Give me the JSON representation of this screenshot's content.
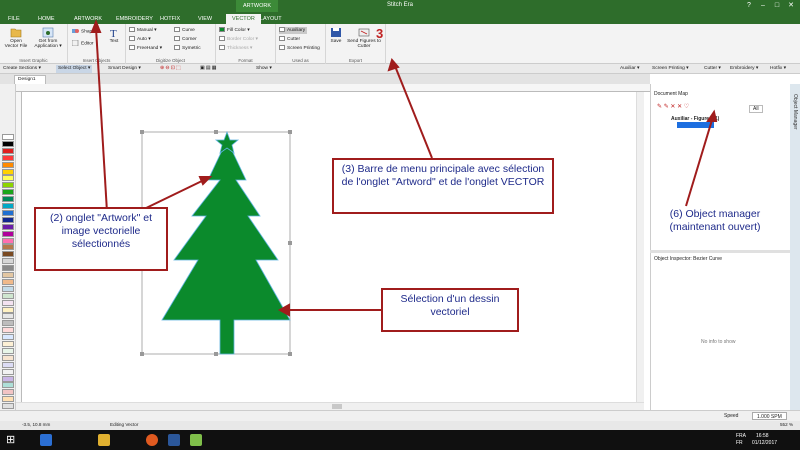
{
  "app": {
    "title": "Stitch Era",
    "context_tab": "ARTWORK"
  },
  "quick_access": {
    "file_label": "FILE"
  },
  "window_buttons": {
    "minimize": "–",
    "maximize": "□",
    "close": "✕",
    "help": "?"
  },
  "tabs": [
    {
      "label": "FILE"
    },
    {
      "label": "HOME"
    },
    {
      "label": "ARTWORK"
    },
    {
      "label": "EMBROIDERY"
    },
    {
      "label": "HOTFIX"
    },
    {
      "label": "VIEW"
    },
    {
      "label": "VECTOR",
      "active": true
    },
    {
      "label": "LAYOUT"
    }
  ],
  "ribbon": {
    "insert_graphic": {
      "label": "Insert Graphic",
      "open_vector": "Open Vector File",
      "get_from_app": "Get from Application ▾"
    },
    "insert_objects": {
      "label": "Insert Objects",
      "shapes": "Shapes",
      "editor": "Editor",
      "text": "Text"
    },
    "digitize_object": {
      "label": "Digitize Object",
      "manual": "Manual ▾",
      "auto": "Auto ▾",
      "freehand": "FreeHand ▾",
      "curve": "Curve",
      "corner": "Corner",
      "symmetric": "Symetric"
    },
    "format": {
      "label": "Format",
      "fill_color": "Fill Color ▾",
      "border_color": "Border Color ▾",
      "thickness": "Thickness ▾"
    },
    "used_as": {
      "label": "Used as",
      "auxiliary": "Auxiliary",
      "cutter": "Cutter",
      "screen_printing": "Screen Printing"
    },
    "export": {
      "label": "Export",
      "save": "Save",
      "send_figures": "Send Figures to Cutter"
    }
  },
  "toolbar2": {
    "create_sections": "Create Sections ▾",
    "select_object": "Select Object ▾",
    "smart_design": "Smart Design ▾",
    "show": "Show ▾",
    "auxiliar": "Auxiliar ▾",
    "screen_printing": "Screen Printing ▾",
    "cutter": "Cutter ▾",
    "embroidery": "Embroidery ▾",
    "hotfix": "Hotfix ▾"
  },
  "doc_tab": "Design1",
  "document_map": {
    "title": "Document Map",
    "tab_all": "All",
    "group": "Auxiliar - Figures (1)",
    "item": "Bezier Curve"
  },
  "object_inspector": {
    "title": "Object Inspector: Bezier Curve",
    "empty": "No info to show"
  },
  "sidebar_label": "Object Manager",
  "speed": {
    "label": "Speed",
    "value": "1.000 SPM"
  },
  "status": {
    "coords": "-3.5, 10.8 mm",
    "mode": "Editing Vector",
    "zoom": "552 %"
  },
  "taskbar": {
    "lang": "FRA",
    "locale": "FR",
    "time": "16:58",
    "date": "01/12/2017"
  },
  "annotations": {
    "a3": "(3) Barre de menu principale avec sélection de l'onglet \"Artword\" et de l'onglet VECTOR",
    "a3_num": "3",
    "a2": "(2) onglet \"Artwork\" et image vectorielle sélectionnés",
    "a6": "(6) Object manager (maintenant ouvert)",
    "sel": "Sélection d'un dessin vectoriel"
  },
  "colors": {
    "title_green": "#2e6d2b",
    "tree_green": "#0b8a2c",
    "annot_border": "#a01c1c",
    "annot_text": "#1e2a8a"
  },
  "palette": [
    "#ffffff",
    "#000000",
    "#e01f1f",
    "#ff3a3a",
    "#ff8a00",
    "#ffd100",
    "#ffff5a",
    "#8dd400",
    "#1aa51a",
    "#00875a",
    "#00a8c6",
    "#1f6fd1",
    "#12278f",
    "#6a1ca8",
    "#b0009a",
    "#ff6fb0",
    "#b5794a",
    "#7a4a22",
    "#d6d6d6",
    "#8a8a8a",
    "#e3c7a3",
    "#f0b98a",
    "#c3dbe8",
    "#cfe6cf",
    "#f3e2f0",
    "#fff1c2",
    "#e6e6e6",
    "#bdbdbd",
    "#ffd9d9",
    "#d9e8ff",
    "#fdf0d5",
    "#e8f5e8",
    "#f7e4d0",
    "#dcdcf5",
    "#f2f2f2",
    "#c9b5e6",
    "#aee0d8",
    "#f2c4c4",
    "#ffe0b3",
    "#e0e0e0",
    "#cccccc",
    "#9e9e9e",
    "#7f7f7f",
    "#5a5a5a"
  ]
}
